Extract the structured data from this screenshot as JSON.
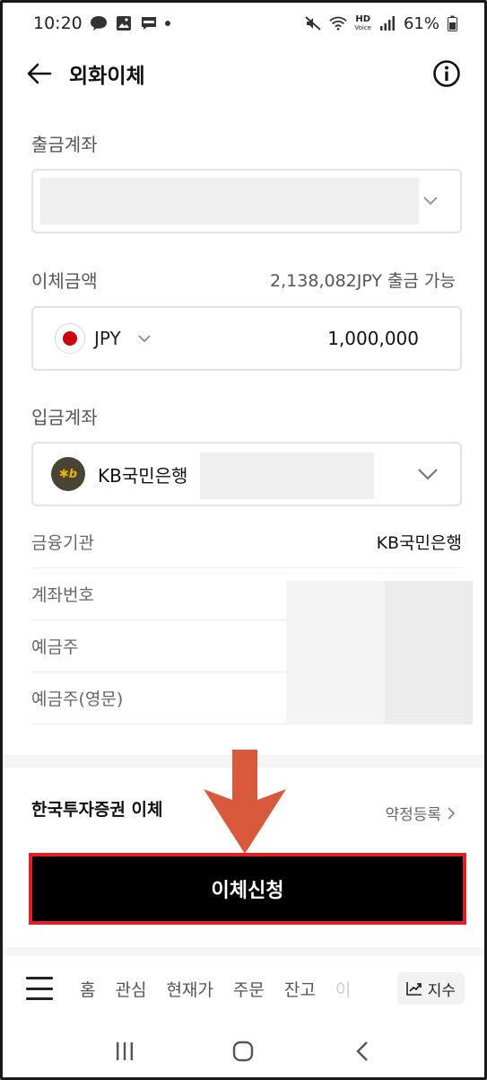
{
  "status_bar": {
    "time": "10:20",
    "battery": "61%",
    "hd_label": "HD",
    "volte_label": "Voice"
  },
  "header": {
    "title": "외화이체"
  },
  "withdraw": {
    "label": "출금계좌"
  },
  "transfer": {
    "label": "이체금액",
    "available_note": "2,138,082JPY 출금 가능",
    "currency": "JPY",
    "amount": "1,000,000"
  },
  "deposit": {
    "label": "입금계좌",
    "bank_name": "KB국민은행",
    "logo_text": "✱b"
  },
  "details": {
    "rows": [
      {
        "label": "금융기관",
        "value": "KB국민은행"
      },
      {
        "label": "계좌번호",
        "value": ""
      },
      {
        "label": "예금주",
        "value": ""
      },
      {
        "label": "예금주(영문)",
        "value": ""
      }
    ]
  },
  "kis": {
    "title": "한국투자증권 이체",
    "agree_link": "약정등록"
  },
  "submit": {
    "label": "이체신청"
  },
  "bottom_nav": {
    "items": [
      "홈",
      "관심",
      "현재가",
      "주문",
      "잔고",
      "이"
    ],
    "index_label": "지수"
  },
  "colors": {
    "highlight_border": "#e31e24",
    "arrow": "#d9593d",
    "button_bg": "#000000"
  }
}
